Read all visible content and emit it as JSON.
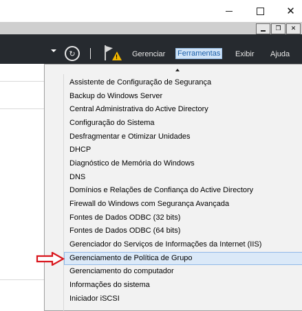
{
  "window": {
    "minimize_icon": "minimize-icon",
    "maximize_icon": "maximize-icon",
    "close_icon": "close-icon",
    "close_glyph": "✕"
  },
  "inner_window": {
    "restore_glyph": "❐",
    "close_glyph": "✕"
  },
  "toolbar": {
    "refresh_glyph": "↻",
    "warning_mark": "!",
    "menus": [
      {
        "label": "Gerenciar"
      },
      {
        "label": "Ferramentas",
        "active": true
      },
      {
        "label": "Exibir"
      },
      {
        "label": "Ajuda"
      }
    ]
  },
  "tools_menu": {
    "items": [
      {
        "label": "Assistente de Configuração de Segurança"
      },
      {
        "label": "Backup do Windows Server"
      },
      {
        "label": "Central Administrativa do Active Directory"
      },
      {
        "label": "Configuração do Sistema"
      },
      {
        "label": "Desfragmentar e Otimizar Unidades"
      },
      {
        "label": "DHCP"
      },
      {
        "label": "Diagnóstico de Memória do Windows"
      },
      {
        "label": "DNS"
      },
      {
        "label": "Domínios e Relações de Confiança do Active Directory"
      },
      {
        "label": "Firewall do Windows com Segurança Avançada"
      },
      {
        "label": "Fontes de Dados ODBC (32 bits)"
      },
      {
        "label": "Fontes de Dados ODBC (64 bits)"
      },
      {
        "label": "Gerenciador do Serviços de Informações da Internet (IIS)"
      },
      {
        "label": "Gerenciamento de Política de Grupo",
        "highlighted": true
      },
      {
        "label": "Gerenciamento do computador"
      },
      {
        "label": "Informações do sistema"
      },
      {
        "label": "Iniciador iSCSI"
      }
    ]
  },
  "annotation": {
    "arrow_color": "#d9141b"
  },
  "colors": {
    "toolbar_bg": "#262a2f",
    "menu_bg": "#f2f2f2",
    "highlight_bg": "#dbe9f8",
    "active_menu_text": "#1a5ea8"
  }
}
